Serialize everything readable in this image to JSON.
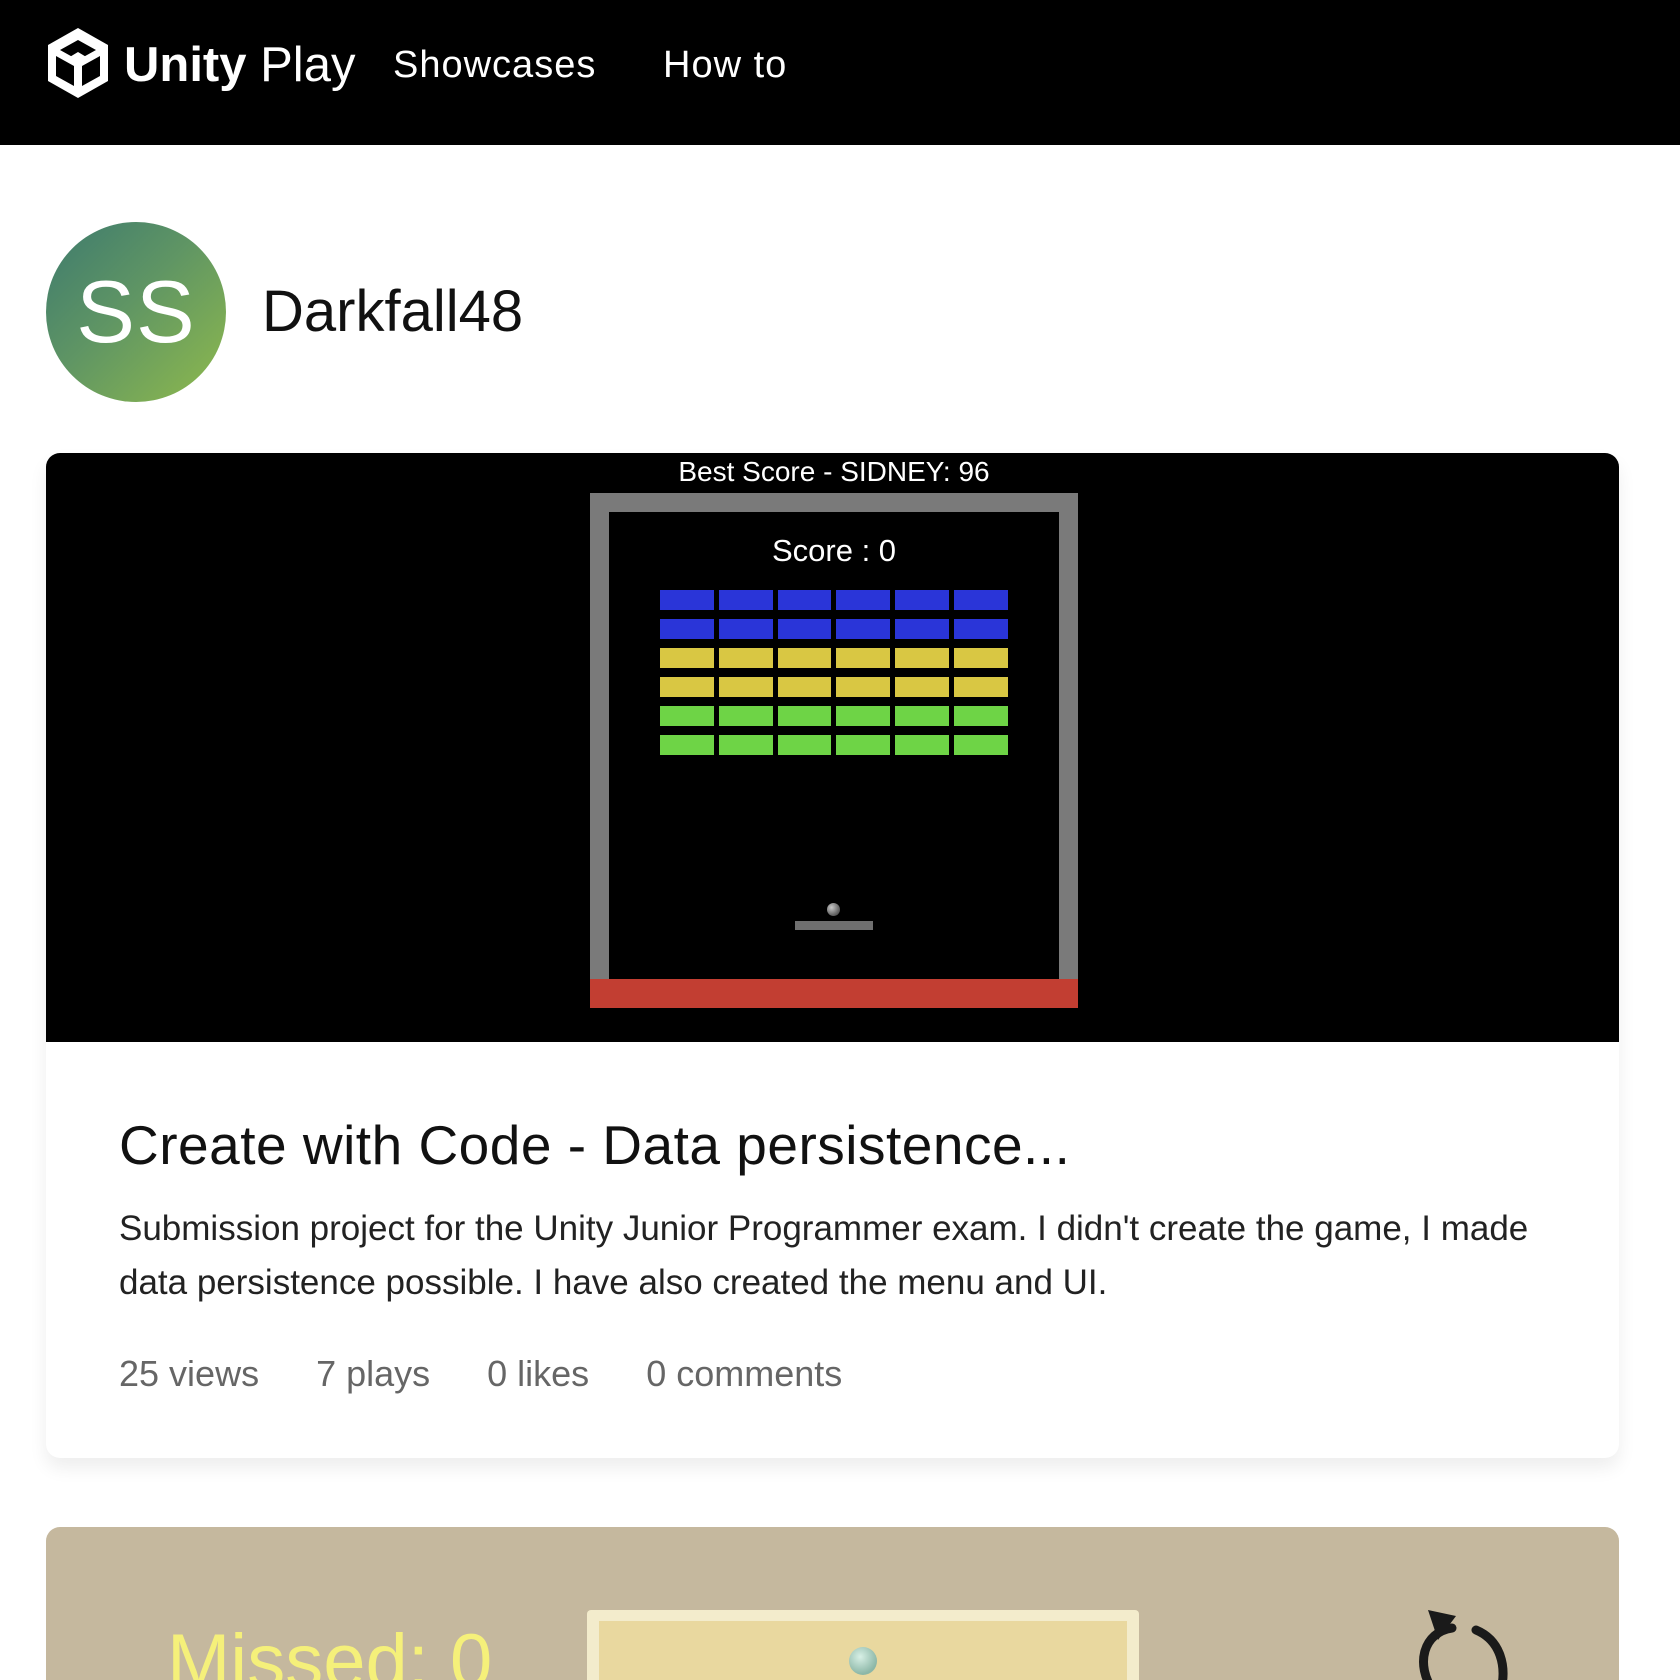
{
  "header": {
    "brand_bold": "Unity",
    "brand_light": "Play",
    "nav": [
      "Showcases",
      "How to"
    ]
  },
  "profile": {
    "initials": "SS",
    "username": "Darkfall48"
  },
  "game1": {
    "best_score": "Best Score - SIDNEY: 96",
    "score": "Score : 0",
    "brick_rows": [
      "#2a35d8",
      "#2a35d8",
      "#d9c743",
      "#d9c743",
      "#6ed446",
      "#6ed446"
    ],
    "bricks_per_row": 6
  },
  "project": {
    "title": "Create with Code - Data persistence...",
    "description": "Submission project for the Unity Junior Programmer exam. I didn't create the game, I made data persistence possible. I have also created the menu and UI.",
    "stats": {
      "views": "25 views",
      "plays": "7 plays",
      "likes": "0 likes",
      "comments": "0 comments"
    }
  },
  "game2": {
    "missed": "Missed: 0"
  }
}
